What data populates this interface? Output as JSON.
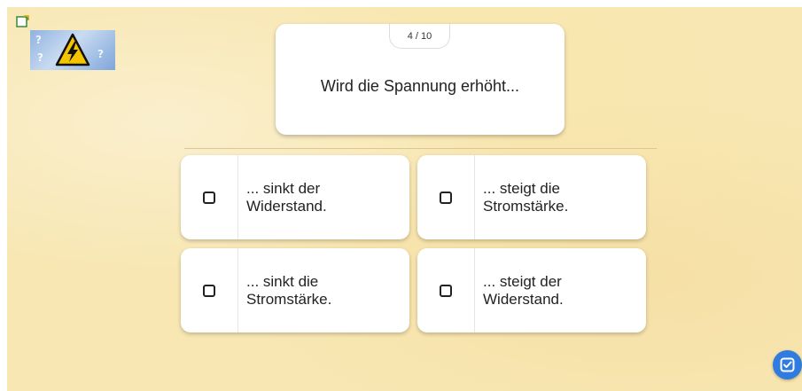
{
  "quiz": {
    "counter": "4 / 10",
    "question": "Wird die Spannung erhöht...",
    "answers": [
      {
        "label": "... sinkt der\nWiderstand."
      },
      {
        "label": "... steigt die\nStromstärke."
      },
      {
        "label": "... sinkt die\nStromstärke."
      },
      {
        "label": "... steigt der\nWiderstand."
      }
    ]
  },
  "colors": {
    "background": "#f8e7b3",
    "accent": "#2f7be0",
    "warning_yellow": "#f5c400"
  },
  "icons": {
    "quiz": "quiz-edit-icon",
    "thumbnail": "high-voltage-warning-icon",
    "submit": "check-square-icon"
  }
}
